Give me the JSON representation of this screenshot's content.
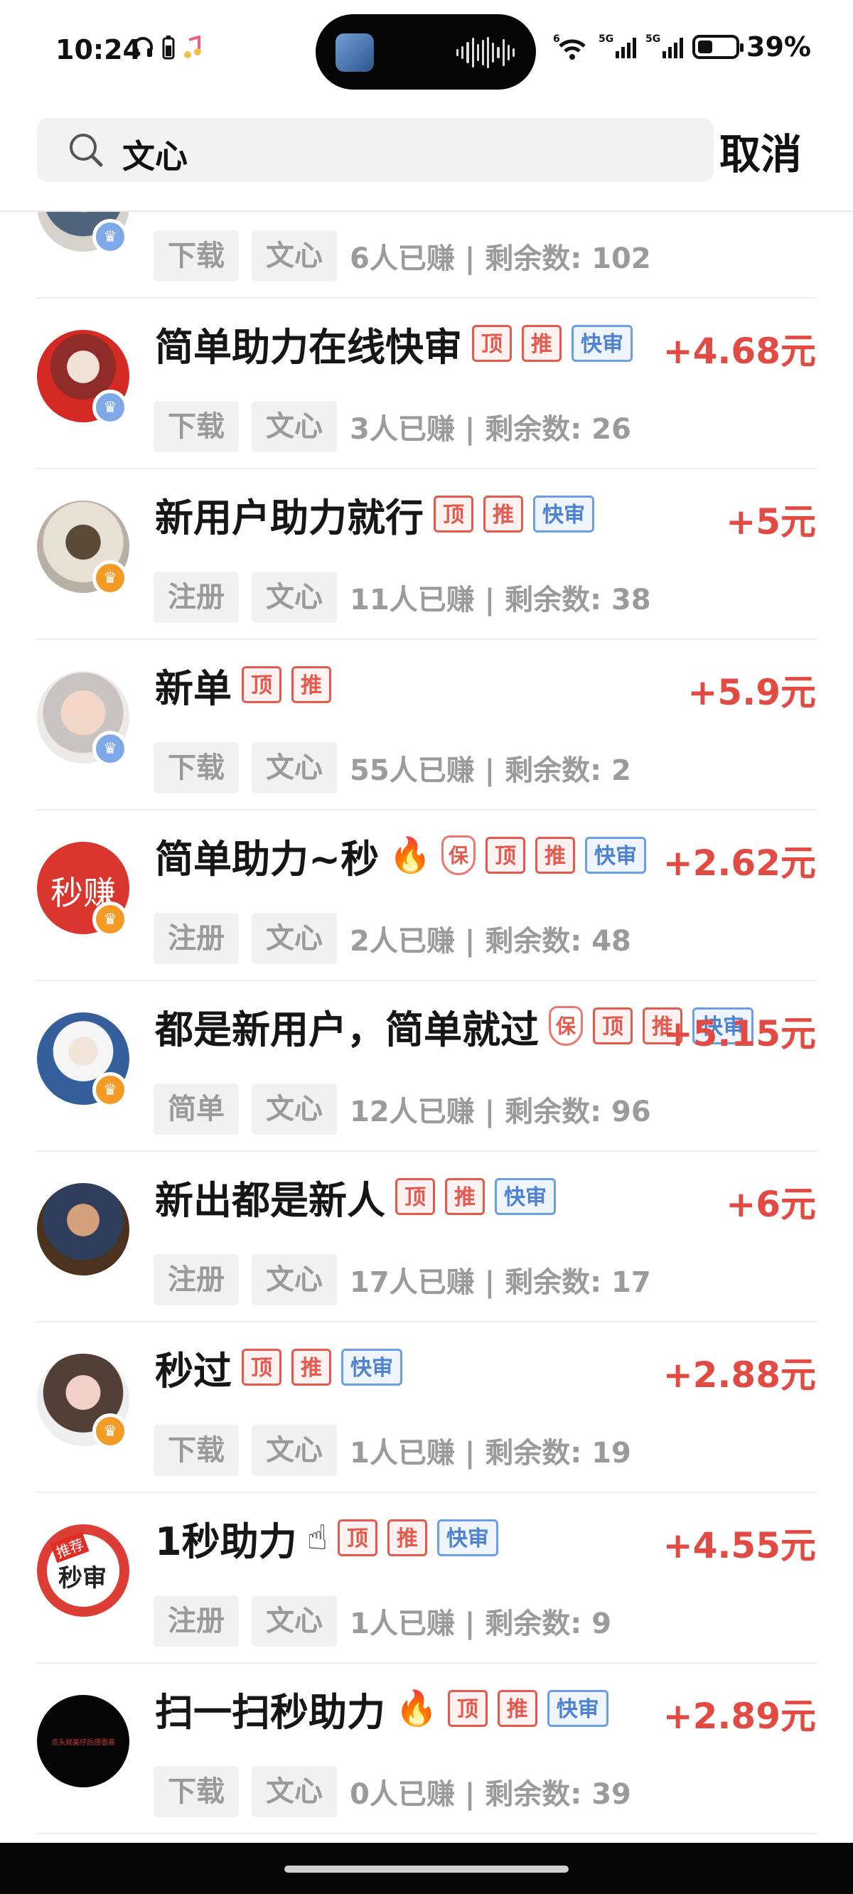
{
  "status_bar": {
    "time": "10:24",
    "battery_percent": "39%",
    "battery_level": 39,
    "network1": "5G",
    "network2": "5G",
    "wifi_label": "6"
  },
  "search": {
    "query": "文心",
    "cancel_label": "取消"
  },
  "tasks": [
    {
      "title": "",
      "tags": [],
      "reward": "",
      "action": "下载",
      "keyword": "文心",
      "stats": "6人已赚 | 剩余数: 102",
      "badge": "blue",
      "redpack": "¥"
    },
    {
      "title": "简单助力在线快审",
      "tags": [
        "顶",
        "推",
        "快审"
      ],
      "reward": "+4.68元",
      "action": "下载",
      "keyword": "文心",
      "stats": "3人已赚 | 剩余数: 26",
      "badge": "blue"
    },
    {
      "title": "新用户助力就行",
      "tags": [
        "顶",
        "推",
        "快审"
      ],
      "reward": "+5元",
      "action": "注册",
      "keyword": "文心",
      "stats": "11人已赚 | 剩余数: 38",
      "badge": "orange"
    },
    {
      "title": "新单",
      "tags": [
        "顶",
        "推"
      ],
      "reward": "+5.9元",
      "action": "下载",
      "keyword": "文心",
      "stats": "55人已赚 | 剩余数: 2",
      "badge": "blue"
    },
    {
      "title": "简单助力~秒",
      "emoji": "🔥",
      "tags": [
        "保",
        "顶",
        "推",
        "快审"
      ],
      "reward": "+2.62元",
      "action": "注册",
      "keyword": "文心",
      "stats": "2人已赚 | 剩余数: 48",
      "badge": "orange",
      "avatar_text": "秒赚"
    },
    {
      "title": "都是新用户，简单就过",
      "tags": [
        "保",
        "顶",
        "推",
        "快审"
      ],
      "reward": "+5.15元",
      "action": "简单",
      "keyword": "文心",
      "stats": "12人已赚 | 剩余数: 96",
      "badge": "orange"
    },
    {
      "title": "新出都是新人",
      "tags": [
        "顶",
        "推",
        "快审"
      ],
      "reward": "+6元",
      "action": "注册",
      "keyword": "文心",
      "stats": "17人已赚 | 剩余数: 17"
    },
    {
      "title": "秒过",
      "tags": [
        "顶",
        "推",
        "快审"
      ],
      "reward": "+2.88元",
      "action": "下载",
      "keyword": "文心",
      "stats": "1人已赚 | 剩余数: 19",
      "badge": "orange"
    },
    {
      "title": "1秒助力",
      "emoji": "☝",
      "tags": [
        "顶",
        "推",
        "快审"
      ],
      "reward": "+4.55元",
      "action": "注册",
      "keyword": "文心",
      "stats": "1人已赚 | 剩余数: 9",
      "avatar_text": "秒审",
      "avatar_small": "推荐"
    },
    {
      "title": "扫一扫秒助力",
      "emoji": "🔥",
      "tags": [
        "顶",
        "推",
        "快审"
      ],
      "reward": "+2.89元",
      "action": "下载",
      "keyword": "文心",
      "stats": "0人已赚 | 剩余数: 39",
      "avatar_text": "点头就美仔后感恩高"
    }
  ],
  "colors": {
    "accent_red": "#e24b43",
    "tag_blue": "#4f83d2"
  }
}
